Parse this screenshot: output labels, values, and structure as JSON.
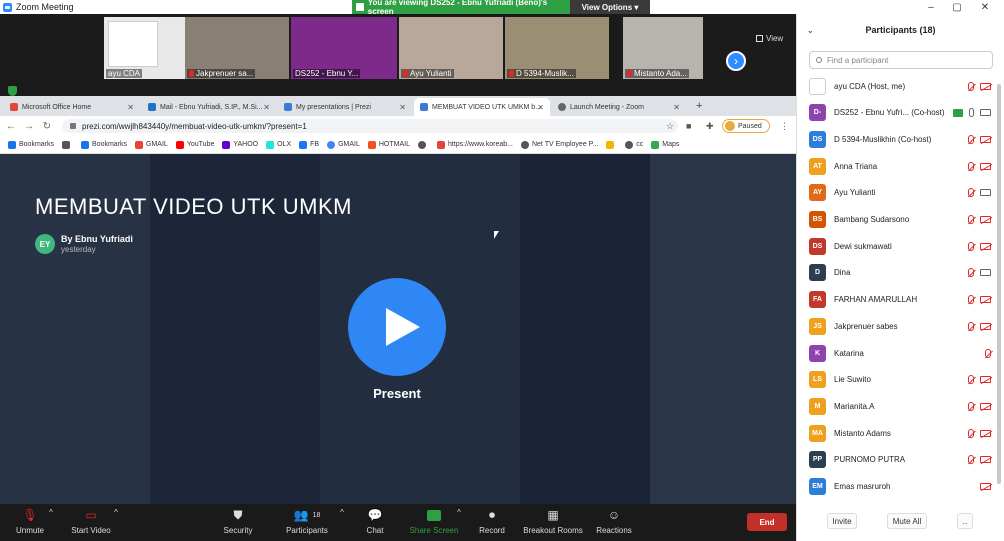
{
  "window": {
    "title": "Zoom Meeting"
  },
  "share_banner": {
    "text": "You are viewing DS252 - Ebnu Yufriadi (Beno)'s screen",
    "options_label": "View Options"
  },
  "thumbnails": [
    {
      "name": "ayu CDA"
    },
    {
      "name": "Jakprenuer sa..."
    },
    {
      "name": "DS252 - Ebnu Y..."
    },
    {
      "name": "Ayu Yulianti"
    },
    {
      "name": "D 5394-Muslik..."
    },
    {
      "name": "Mistanto Ada..."
    }
  ],
  "view_button": {
    "label": "View"
  },
  "browser": {
    "tabs": [
      {
        "label": "Microsoft Office Home"
      },
      {
        "label": "Mail - Ebnu Yufriadi, S.IP., M.Si..."
      },
      {
        "label": "My presentations | Prezi"
      },
      {
        "label": "MEMBUAT VIDEO UTK UMKM b..."
      },
      {
        "label": "Launch Meeting - Zoom"
      }
    ],
    "url": "prezi.com/wwjlh843440y/membuat-video-utk-umkm/?present=1",
    "profile_status": "Paused",
    "bookmarks": [
      {
        "label": "Bookmarks"
      },
      {
        "label": "GMAIL"
      },
      {
        "label": "YouTube"
      },
      {
        "label": "YAHOO"
      },
      {
        "label": "OLX"
      },
      {
        "label": "FB"
      },
      {
        "label": "GMAIL"
      },
      {
        "label": "HOTMAIL"
      },
      {
        "label": "https://www.koreab..."
      },
      {
        "label": "Net TV Employee P..."
      },
      {
        "label": "cc"
      },
      {
        "label": "Maps"
      }
    ]
  },
  "prezi": {
    "title": "MEMBUAT VIDEO UTK UMKM",
    "author_initials": "EY",
    "author": "By Ebnu Yufriadi",
    "when": "yesterday",
    "present_label": "Present"
  },
  "toolbar": {
    "unmute": "Unmute",
    "start_video": "Start Video",
    "security": "Security",
    "participants": "Participants",
    "participants_count": "18",
    "chat": "Chat",
    "share_screen": "Share Screen",
    "record": "Record",
    "breakout": "Breakout Rooms",
    "reactions": "Reactions",
    "end": "End"
  },
  "panel": {
    "title": "Participants (18)",
    "search_placeholder": "Find a participant",
    "participants": [
      {
        "initials": "",
        "name": "ayu CDA (Host, me)",
        "color": "#ffffff",
        "mic": "muted",
        "cam": "off"
      },
      {
        "initials": "D-",
        "name": "DS252 - Ebnu Yufri... (Co-host)",
        "color": "#8e44ad",
        "mic": "on",
        "cam": "on",
        "sharing": true
      },
      {
        "initials": "DS",
        "name": "D 5394-Muslikhin (Co-host)",
        "color": "#2d7ed8",
        "mic": "muted",
        "cam": "off"
      },
      {
        "initials": "AT",
        "name": "Anna Triana",
        "color": "#f0a020",
        "mic": "muted",
        "cam": "off"
      },
      {
        "initials": "AY",
        "name": "Ayu Yulianti",
        "color": "#e06a1a",
        "mic": "muted",
        "cam": "on"
      },
      {
        "initials": "BS",
        "name": "Bambang Sudarsono",
        "color": "#d35400",
        "mic": "muted",
        "cam": "off"
      },
      {
        "initials": "DS",
        "name": "Dewi sukmawati",
        "color": "#c0392b",
        "mic": "muted",
        "cam": "off"
      },
      {
        "initials": "D",
        "name": "Dina",
        "color": "#2c3e50",
        "mic": "muted",
        "cam": "on"
      },
      {
        "initials": "FA",
        "name": "FARHAN AMARULLAH",
        "color": "#c0392b",
        "mic": "muted",
        "cam": "off"
      },
      {
        "initials": "JS",
        "name": "Jakprenuer sabes",
        "color": "#f0a020",
        "mic": "muted",
        "cam": "off"
      },
      {
        "initials": "K",
        "name": "Katarina",
        "color": "#8e44ad",
        "mic": "muted",
        "cam": "none"
      },
      {
        "initials": "LS",
        "name": "Lie Suwito",
        "color": "#f0a020",
        "mic": "muted",
        "cam": "off"
      },
      {
        "initials": "M",
        "name": "Marianita.A",
        "color": "#f0a020",
        "mic": "muted",
        "cam": "off"
      },
      {
        "initials": "MA",
        "name": "Mistanto Adams",
        "color": "#f0a020",
        "mic": "muted",
        "cam": "off"
      },
      {
        "initials": "PP",
        "name": "PURNOMO PUTRA",
        "color": "#2c3e50",
        "mic": "muted",
        "cam": "off"
      },
      {
        "initials": "EM",
        "name": "Emas masruroh",
        "color": "#2d7ed8",
        "mic": "none",
        "cam": "off"
      }
    ],
    "invite": "Invite",
    "mute_all": "Mute All",
    "more": ".."
  }
}
